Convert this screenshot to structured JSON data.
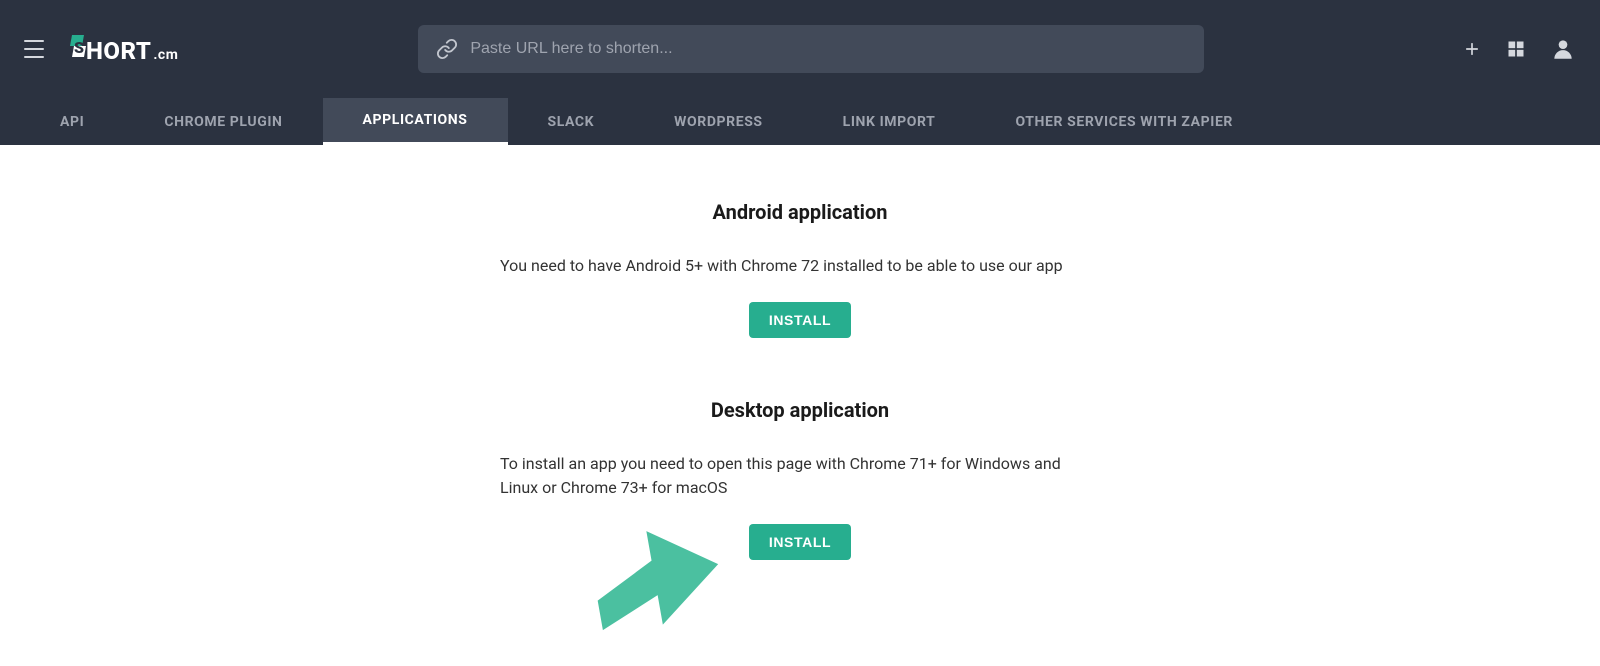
{
  "header": {
    "logo_text": "HORT",
    "logo_suffix": ".cm",
    "url_input_placeholder": "Paste URL here to shorten..."
  },
  "tabs": [
    {
      "label": "API",
      "active": false
    },
    {
      "label": "CHROME PLUGIN",
      "active": false
    },
    {
      "label": "APPLICATIONS",
      "active": true
    },
    {
      "label": "SLACK",
      "active": false
    },
    {
      "label": "WORDPRESS",
      "active": false
    },
    {
      "label": "LINK IMPORT",
      "active": false
    },
    {
      "label": "OTHER SERVICES WITH ZAPIER",
      "active": false
    }
  ],
  "sections": {
    "android": {
      "title": "Android application",
      "description": "You need to have Android 5+ with Chrome 72 installed to be able to use our app",
      "button": "INSTALL"
    },
    "desktop": {
      "title": "Desktop application",
      "description": "To install an app you need to open this page with Chrome 71+ for Windows and Linux or Chrome 73+ for macOS",
      "button": "INSTALL"
    }
  },
  "colors": {
    "accent": "#27ae8f",
    "header_bg": "#2b3240",
    "tab_active_bg": "#424a59"
  }
}
